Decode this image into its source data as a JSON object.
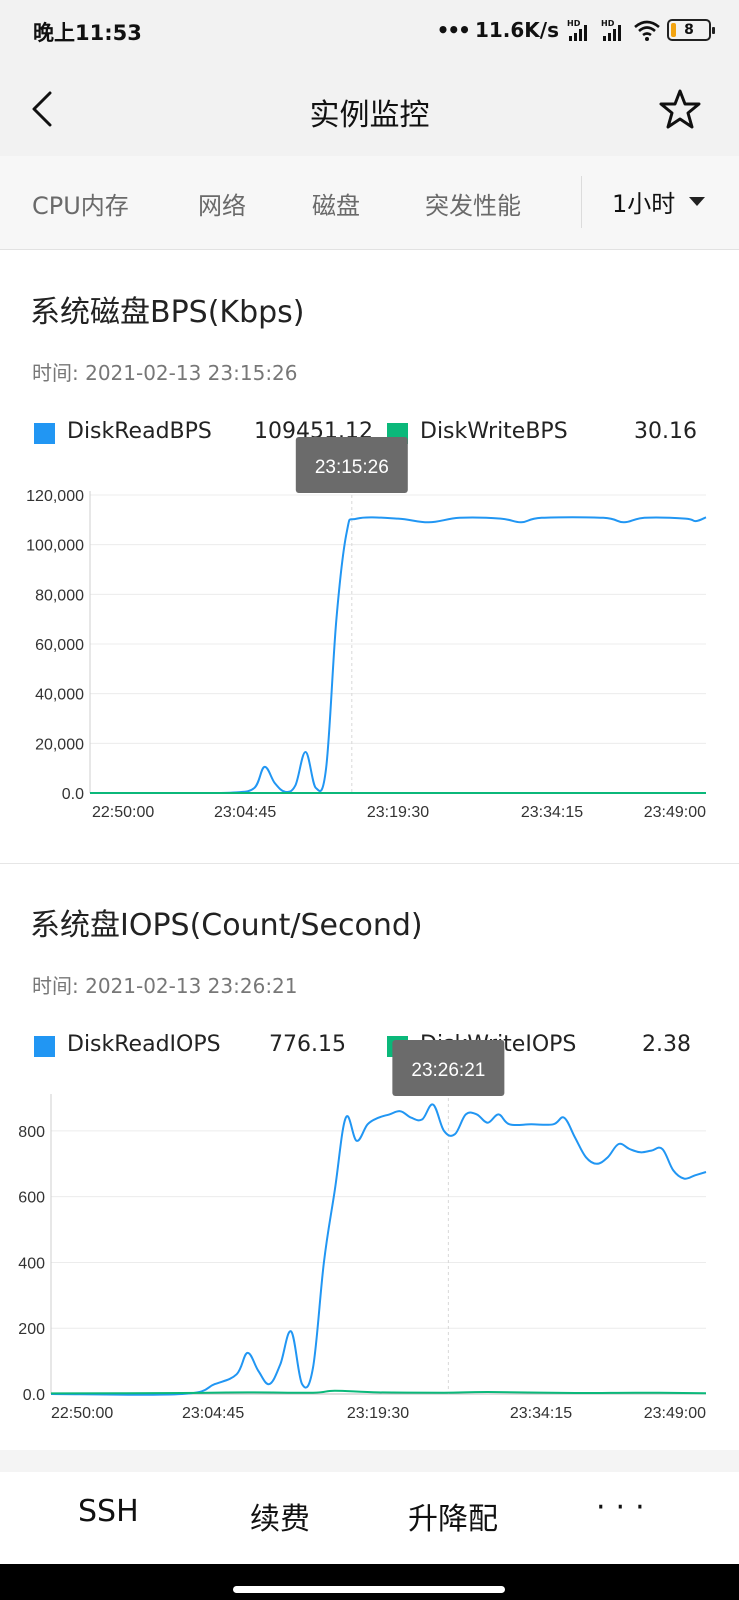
{
  "status_bar": {
    "time": "晚上11:53",
    "net_speed": "11.6K/s",
    "hd_label": "HD",
    "battery": "8",
    "icons": [
      "dots-icon",
      "signal-icon",
      "signal-icon",
      "wifi-icon",
      "battery-icon"
    ]
  },
  "header": {
    "title": "实例监控",
    "back_icon": "chevron-left-icon",
    "star_icon": "star-outline-icon"
  },
  "tabs": {
    "items": [
      "CPU内存",
      "网络",
      "磁盘",
      "突发性能"
    ],
    "range": "1小时"
  },
  "charts": [
    {
      "title": "系统磁盘BPS(Kbps)",
      "time_label": "时间: 2021-02-13 23:15:26",
      "tooltip": "23:15:26",
      "legend": [
        {
          "name": "DiskReadBPS",
          "value": "109451.12",
          "color": "#2196f3"
        },
        {
          "name": "DiskWriteBPS",
          "value": "30.16",
          "color": "#0bb87a"
        }
      ],
      "y_ticks": [
        "120,000",
        "100,000",
        "80,000",
        "60,000",
        "40,000",
        "20,000",
        "0.0"
      ],
      "x_ticks": [
        "22:50:00",
        "23:04:45",
        "23:19:30",
        "23:34:15",
        "23:49:00"
      ]
    },
    {
      "title": "系统盘IOPS(Count/Second)",
      "time_label": "时间: 2021-02-13 23:26:21",
      "tooltip": "23:26:21",
      "legend": [
        {
          "name": "DiskReadIOPS",
          "value": "776.15",
          "color": "#2196f3"
        },
        {
          "name": "DiskWriteIOPS",
          "value": "2.38",
          "color": "#0bb87a"
        }
      ],
      "y_ticks": [
        "800",
        "600",
        "400",
        "200",
        "0.0"
      ],
      "x_ticks": [
        "22:50:00",
        "23:04:45",
        "23:19:30",
        "23:34:15",
        "23:49:00"
      ]
    }
  ],
  "chart_data": [
    {
      "type": "line",
      "title": "系统磁盘BPS(Kbps)",
      "x": [
        "22:50:00",
        "23:04:45",
        "23:19:30",
        "23:34:15",
        "23:49:00"
      ],
      "x_range_minutes": [
        0,
        60
      ],
      "ylim": [
        0,
        120000
      ],
      "grid": true,
      "legend_position": "top",
      "series": [
        {
          "name": "DiskReadBPS",
          "color": "#2196f3",
          "points": [
            [
              0,
              0
            ],
            [
              10,
              0
            ],
            [
              14,
              200
            ],
            [
              16,
              2000
            ],
            [
              17,
              10500
            ],
            [
              18,
              4000
            ],
            [
              19,
              500
            ],
            [
              20,
              3000
            ],
            [
              21,
              16500
            ],
            [
              22,
              2000
            ],
            [
              23,
              10000
            ],
            [
              24,
              70000
            ],
            [
              25,
              105000
            ],
            [
              26,
              110500
            ],
            [
              30,
              110500
            ],
            [
              33,
              109000
            ],
            [
              36,
              110800
            ],
            [
              40,
              110500
            ],
            [
              42,
              109000
            ],
            [
              44,
              110800
            ],
            [
              50,
              110800
            ],
            [
              52,
              109000
            ],
            [
              54,
              110800
            ],
            [
              58,
              110500
            ],
            [
              59,
              109500
            ],
            [
              60,
              111000
            ]
          ]
        },
        {
          "name": "DiskWriteBPS",
          "color": "#0bb87a",
          "points": [
            [
              0,
              0
            ],
            [
              30,
              0
            ],
            [
              60,
              0
            ]
          ]
        }
      ]
    },
    {
      "type": "line",
      "title": "系统盘IOPS(Count/Second)",
      "x": [
        "22:50:00",
        "23:04:45",
        "23:19:30",
        "23:34:15",
        "23:49:00"
      ],
      "x_range_minutes": [
        0,
        60
      ],
      "ylim": [
        0,
        900
      ],
      "grid": true,
      "legend_position": "top",
      "series": [
        {
          "name": "DiskReadIOPS",
          "color": "#2196f3",
          "points": [
            [
              0,
              0
            ],
            [
              12,
              0
            ],
            [
              15,
              30
            ],
            [
              17,
              60
            ],
            [
              18,
              125
            ],
            [
              19,
              70
            ],
            [
              20,
              30
            ],
            [
              21,
              90
            ],
            [
              22,
              190
            ],
            [
              23,
              30
            ],
            [
              24,
              80
            ],
            [
              25,
              400
            ],
            [
              26,
              620
            ],
            [
              27,
              840
            ],
            [
              28,
              770
            ],
            [
              29,
              820
            ],
            [
              30,
              840
            ],
            [
              31,
              850
            ],
            [
              32,
              860
            ],
            [
              33,
              840
            ],
            [
              34,
              835
            ],
            [
              35,
              880
            ],
            [
              36,
              800
            ],
            [
              37,
              790
            ],
            [
              38,
              850
            ],
            [
              39,
              850
            ],
            [
              40,
              825
            ],
            [
              41,
              850
            ],
            [
              42,
              820
            ],
            [
              44,
              820
            ],
            [
              46,
              820
            ],
            [
              47,
              840
            ],
            [
              48,
              780
            ],
            [
              49,
              720
            ],
            [
              50,
              700
            ],
            [
              51,
              720
            ],
            [
              52,
              760
            ],
            [
              53,
              745
            ],
            [
              54,
              735
            ],
            [
              55,
              740
            ],
            [
              56,
              745
            ],
            [
              57,
              680
            ],
            [
              58,
              655
            ],
            [
              59,
              665
            ],
            [
              60,
              675
            ]
          ]
        },
        {
          "name": "DiskWriteIOPS",
          "color": "#0bb87a",
          "points": [
            [
              0,
              2
            ],
            [
              12,
              3
            ],
            [
              18,
              5
            ],
            [
              24,
              4
            ],
            [
              26,
              10
            ],
            [
              30,
              5
            ],
            [
              36,
              4
            ],
            [
              40,
              6
            ],
            [
              48,
              3
            ],
            [
              54,
              4
            ],
            [
              60,
              2.4
            ]
          ]
        }
      ]
    }
  ],
  "bottom_bar": {
    "ssh": "SSH",
    "renew": "续费",
    "resize": "升降配",
    "more": "···"
  }
}
